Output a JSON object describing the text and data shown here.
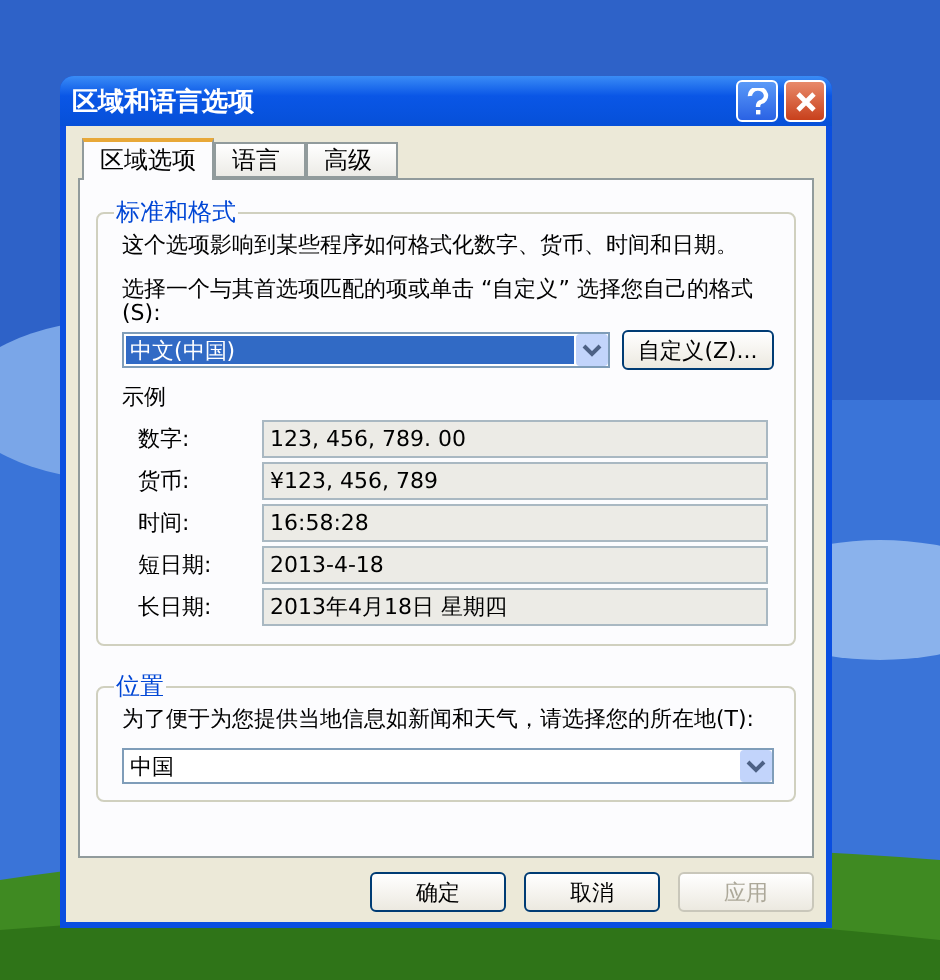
{
  "window": {
    "title": "区域和语言选项"
  },
  "tabs": [
    {
      "label": "区域选项",
      "selected": true
    },
    {
      "label": "语言",
      "selected": false
    },
    {
      "label": "高级",
      "selected": false
    }
  ],
  "standards": {
    "title": "标准和格式",
    "description": "这个选项影响到某些程序如何格式化数字、货币、时间和日期。",
    "prompt": "选择一个与其首选项匹配的项或单击 “自定义” 选择您自己的格式(S):",
    "format": "中文(中国)",
    "customize_button": "自定义(Z)...",
    "samples_title": "示例",
    "samples": [
      {
        "label": "数字:",
        "value": "123, 456, 789. 00"
      },
      {
        "label": "货币:",
        "value": "¥123, 456, 789"
      },
      {
        "label": "时间:",
        "value": "16:58:28"
      },
      {
        "label": "短日期:",
        "value": "2013-4-18"
      },
      {
        "label": "长日期:",
        "value": "2013年4月18日 星期四"
      }
    ]
  },
  "location": {
    "title": "位置",
    "prompt": "为了便于为您提供当地信息如新闻和天气，请选择您的所在地(T):",
    "value": "中国"
  },
  "buttons": [
    {
      "label": "确定",
      "disabled": false
    },
    {
      "label": "取消",
      "disabled": false
    },
    {
      "label": "应用",
      "disabled": true
    }
  ]
}
